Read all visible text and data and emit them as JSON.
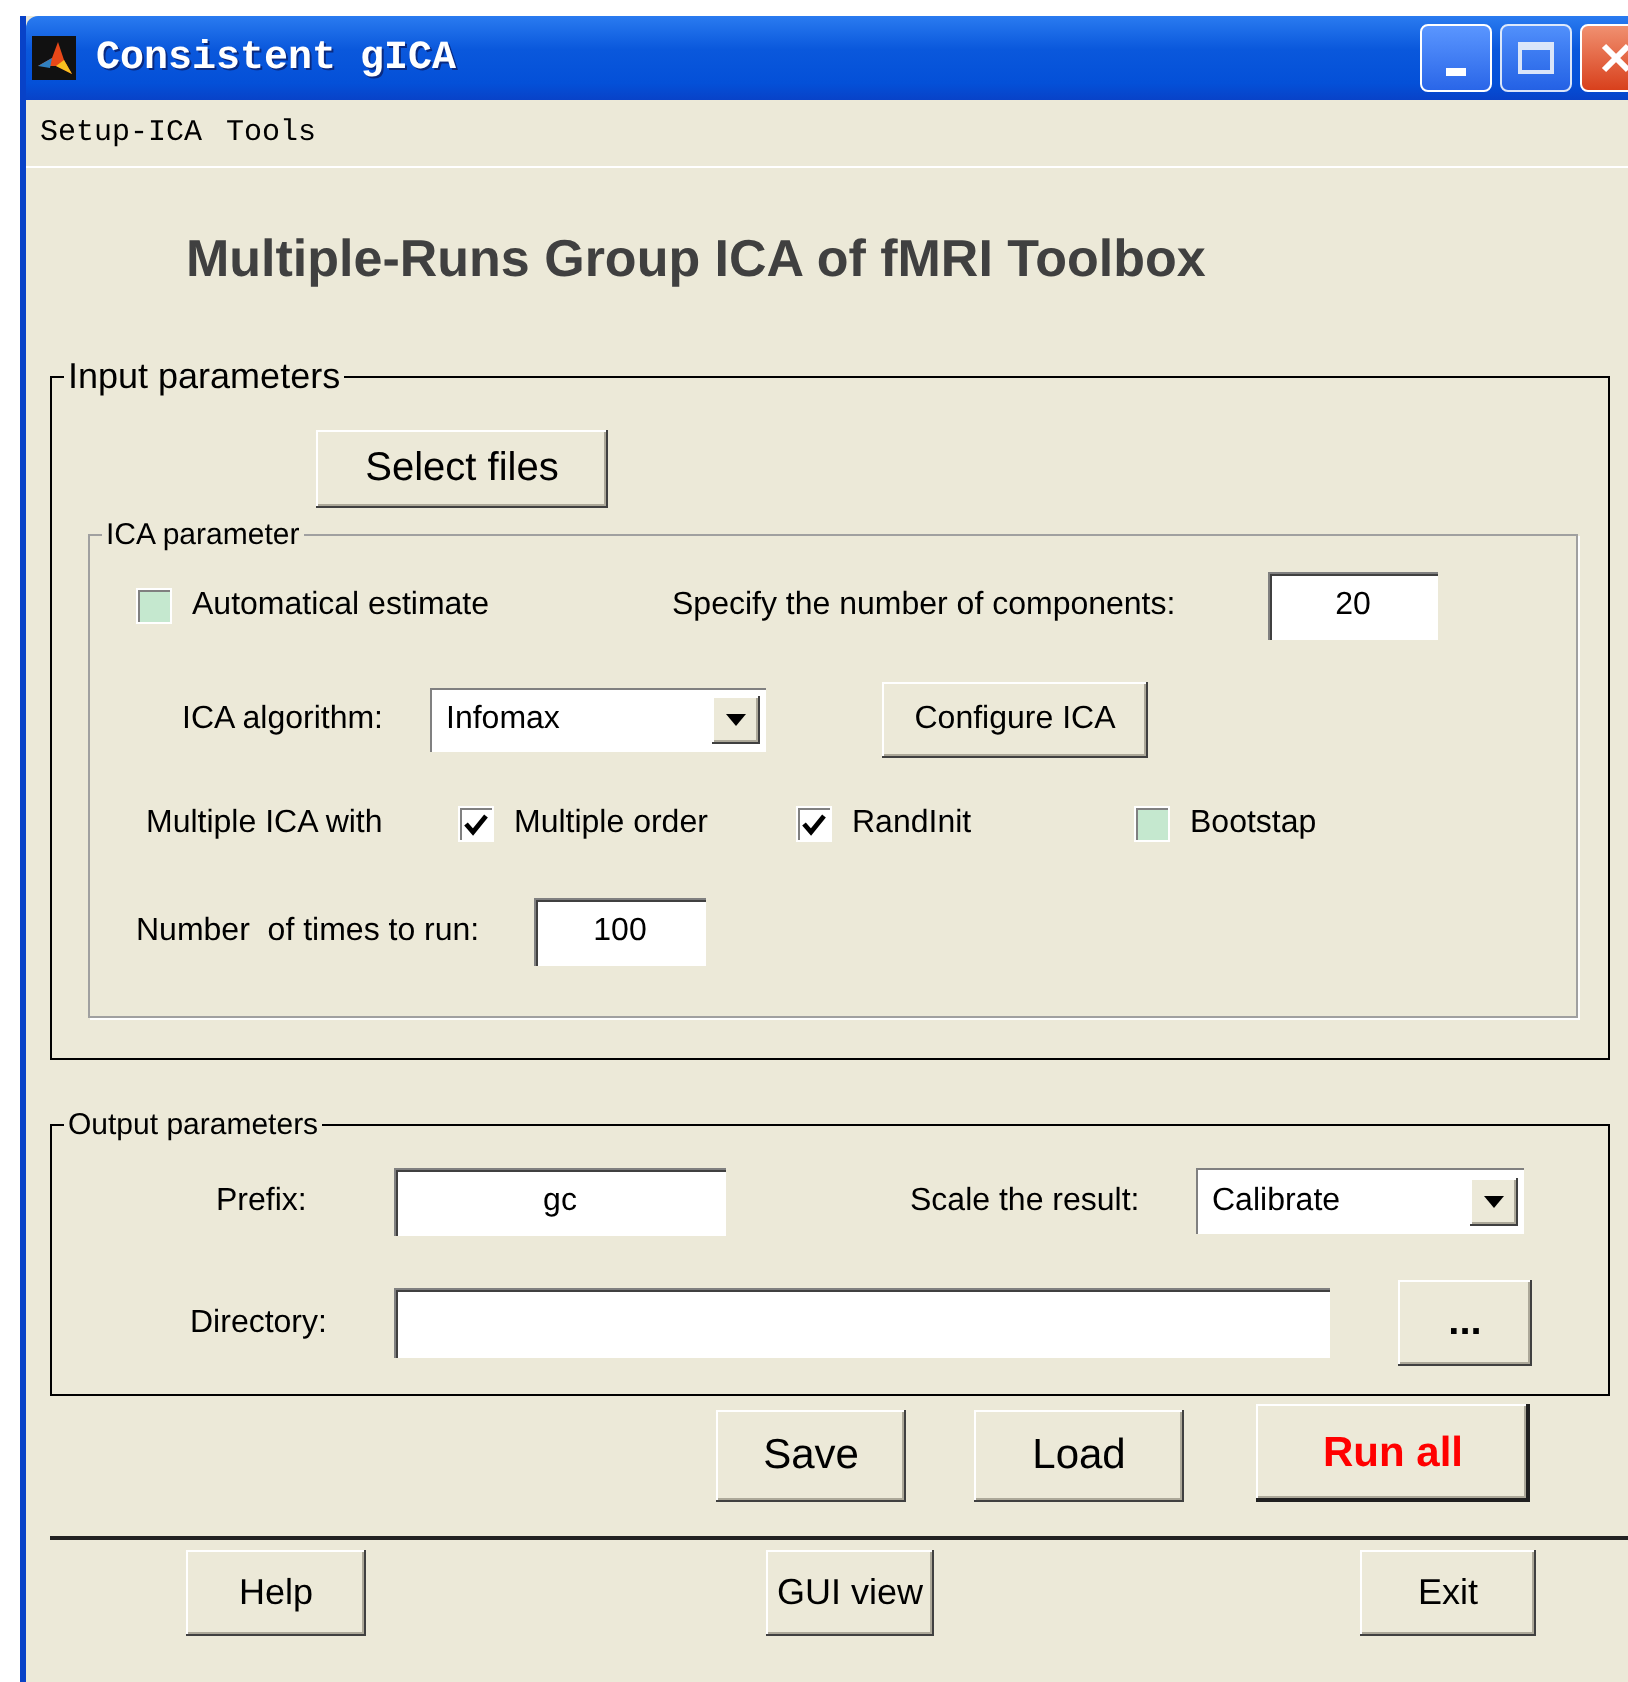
{
  "window": {
    "title": "Consistent gICA"
  },
  "menu": [
    "Setup-ICA",
    "Tools"
  ],
  "heading": "Multiple-Runs Group ICA of fMRI Toolbox",
  "input_parameters": {
    "legend": "Input parameters",
    "select_files": "Select files",
    "ica_parameter": {
      "legend": "ICA parameter",
      "auto_estimate": {
        "label": "Automatical estimate",
        "checked": false
      },
      "components": {
        "label": "Specify the number of components:",
        "value": "20"
      },
      "algorithm": {
        "label": "ICA algorithm:",
        "value": "Infomax"
      },
      "configure": "Configure ICA",
      "multiple_label": "Multiple ICA with",
      "options": [
        {
          "label": "Multiple order",
          "checked": true
        },
        {
          "label": "RandInit",
          "checked": true
        },
        {
          "label": "Bootstap",
          "checked": false
        }
      ],
      "runs": {
        "label": "Number  of times to run:",
        "value": "100"
      }
    }
  },
  "output_parameters": {
    "legend": "Output parameters",
    "prefix": {
      "label": "Prefix:",
      "value": "gc"
    },
    "scale": {
      "label": "Scale the result:",
      "value": "Calibrate"
    },
    "directory": {
      "label": "Directory:"
    },
    "browse": "..."
  },
  "actions": [
    {
      "label": "Save",
      "kind": "normal"
    },
    {
      "label": "Load",
      "kind": "normal"
    },
    {
      "label": "Run all",
      "kind": "primary"
    }
  ],
  "footer": [
    "Help",
    "GUI view",
    "Exit"
  ]
}
